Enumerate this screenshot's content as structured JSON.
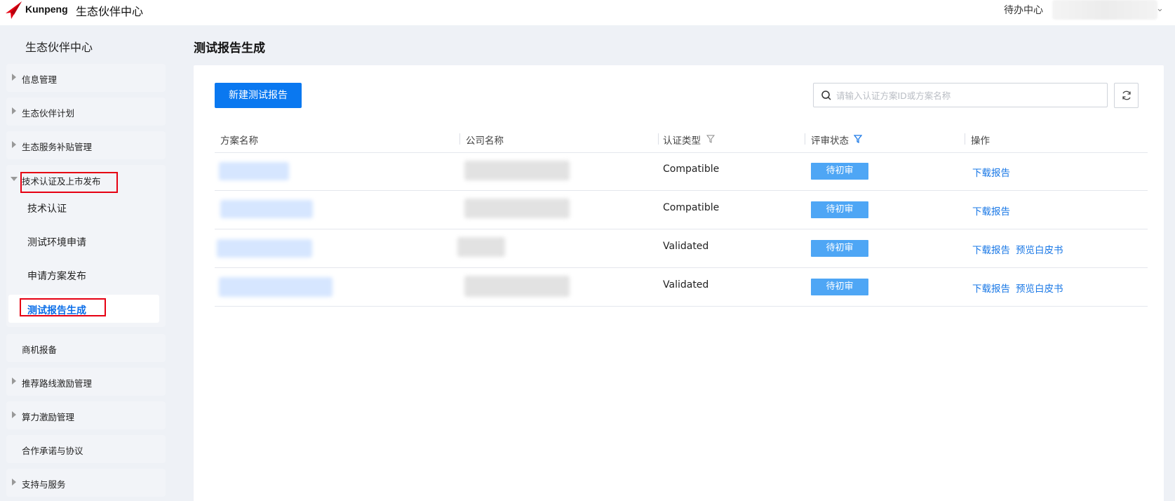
{
  "topbar": {
    "brand": "Kunpeng",
    "title": "生态伙伴中心",
    "todo_label": "待办中心",
    "colors": {
      "logo_red": "#e60012"
    }
  },
  "sidebar": {
    "title": "生态伙伴中心",
    "items": [
      {
        "label": "信息管理",
        "expandable": true
      },
      {
        "label": "生态伙伴计划",
        "expandable": true
      },
      {
        "label": "生态服务补贴管理",
        "expandable": true
      },
      {
        "label": "技术认证及上市发布",
        "expandable": true,
        "expanded": true,
        "children": [
          "技术认证",
          "测试环境申请",
          "申请方案发布",
          "测试报告生成"
        ],
        "active_child": "测试报告生成"
      },
      {
        "label": "商机报备",
        "expandable": false
      },
      {
        "label": "推荐路线激励管理",
        "expandable": true
      },
      {
        "label": "算力激励管理",
        "expandable": true
      },
      {
        "label": "合作承诺与协议",
        "expandable": false
      },
      {
        "label": "支持与服务",
        "expandable": true
      }
    ]
  },
  "main": {
    "page_title": "测试报告生成",
    "new_button": "新建测试报告",
    "search": {
      "placeholder": "请输入认证方案ID或方案名称",
      "value": ""
    },
    "table": {
      "columns": [
        "方案名称",
        "公司名称",
        "认证类型",
        "评审状态",
        "操作"
      ],
      "rows": [
        {
          "cert_type": "Compatible",
          "status": "待初审",
          "actions": [
            "下载报告"
          ]
        },
        {
          "cert_type": "Compatible",
          "status": "待初审",
          "actions": [
            "下载报告"
          ]
        },
        {
          "cert_type": "Validated",
          "status": "待初审",
          "actions": [
            "下载报告",
            "预览白皮书"
          ]
        },
        {
          "cert_type": "Validated",
          "status": "待初审",
          "actions": [
            "下载报告",
            "预览白皮书"
          ]
        }
      ]
    },
    "colors": {
      "primary": "#0a78f0",
      "link": "#1a78e6",
      "badge": "#4ea6f5",
      "highlight_box": "#e60012"
    }
  }
}
